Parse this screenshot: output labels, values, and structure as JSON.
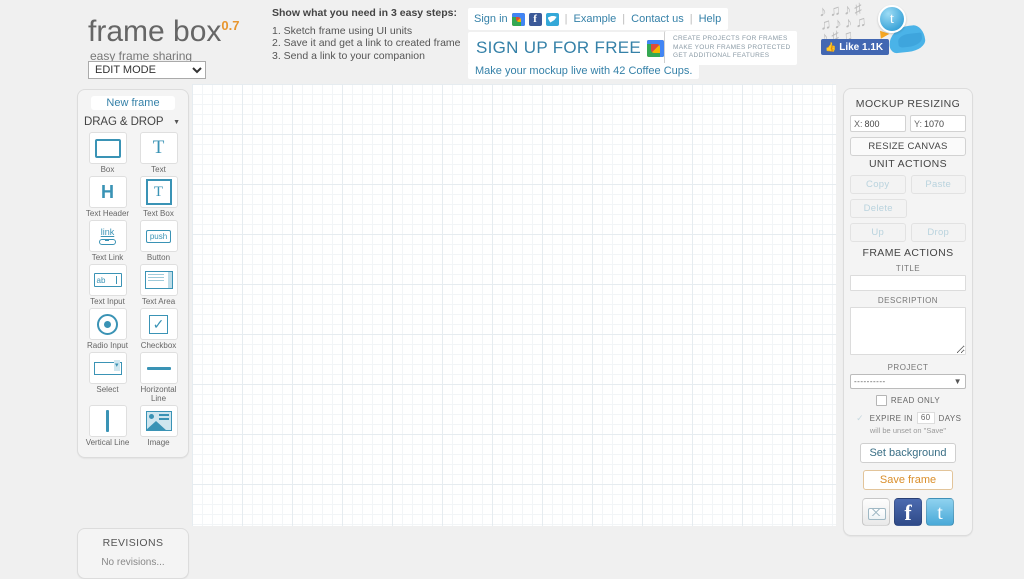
{
  "header": {
    "logo_name": "frame box",
    "logo_version": "0.7",
    "tagline": "easy frame sharing",
    "mode_selected": "EDIT MODE",
    "steps_heading": "Show what you need in 3 easy steps:",
    "steps": [
      "1. Sketch frame using UI units",
      "2. Save it and get a link to created frame",
      "3. Send a link to your companion"
    ],
    "signin_label": "Sign in",
    "signin_links": [
      "Example",
      "Contact us",
      "Help"
    ],
    "signup_label": "SIGN UP FOR FREE",
    "benefits": [
      "CREATE PROJECTS FOR FRAMES",
      "MAKE YOUR FRAMES PROTECTED",
      "GET ADDITIONAL FEATURES"
    ],
    "mockup_tagline": "Make your mockup live with 42 Coffee Cups.",
    "like_label": "Like 1.1K"
  },
  "left_panel": {
    "new_frame_label": "New frame",
    "dragdrop_label": "DRAG & DROP",
    "tools": [
      {
        "label": "Box",
        "icon": "box-icon"
      },
      {
        "label": "Text",
        "icon": "text-icon"
      },
      {
        "label": "Text Header",
        "icon": "text-header-icon"
      },
      {
        "label": "Text Box",
        "icon": "text-box-icon"
      },
      {
        "label": "Text Link",
        "icon": "text-link-icon"
      },
      {
        "label": "Button",
        "icon": "button-icon"
      },
      {
        "label": "Text Input",
        "icon": "text-input-icon"
      },
      {
        "label": "Text Area",
        "icon": "text-area-icon"
      },
      {
        "label": "Radio Input",
        "icon": "radio-input-icon"
      },
      {
        "label": "Checkbox",
        "icon": "checkbox-icon"
      },
      {
        "label": "Select",
        "icon": "select-icon"
      },
      {
        "label": "Horizontal Line",
        "icon": "horizontal-line-icon"
      },
      {
        "label": "Vertical Line",
        "icon": "vertical-line-icon"
      },
      {
        "label": "Image",
        "icon": "image-icon"
      }
    ],
    "revisions_title": "REVISIONS",
    "revisions_empty": "No revisions..."
  },
  "right_panel": {
    "resizing_title": "MOCKUP RESIZING",
    "x_key": "X:",
    "x_value": "800",
    "y_key": "Y:",
    "y_value": "1070",
    "resize_canvas_label": "RESIZE CANVAS",
    "unit_actions_title": "UNIT ACTIONS",
    "copy_label": "Copy",
    "paste_label": "Paste",
    "delete_label": "Delete",
    "up_label": "Up",
    "drop_label": "Drop",
    "frame_actions_title": "FRAME ACTIONS",
    "title_label": "TITLE",
    "title_value": "",
    "description_label": "DESCRIPTION",
    "description_value": "",
    "project_label": "PROJECT",
    "project_value": "----------",
    "read_only_label": "READ ONLY",
    "expire_prefix": "EXPIRE IN",
    "expire_days": "60",
    "expire_suffix": "DAYS",
    "unset_note": "will be unset on \"Save\"",
    "set_background_label": "Set background",
    "save_frame_label": "Save frame"
  },
  "colors": {
    "accent_blue": "#3581a8",
    "accent_orange": "#e8962e",
    "icon_blue": "#3a93b5"
  }
}
